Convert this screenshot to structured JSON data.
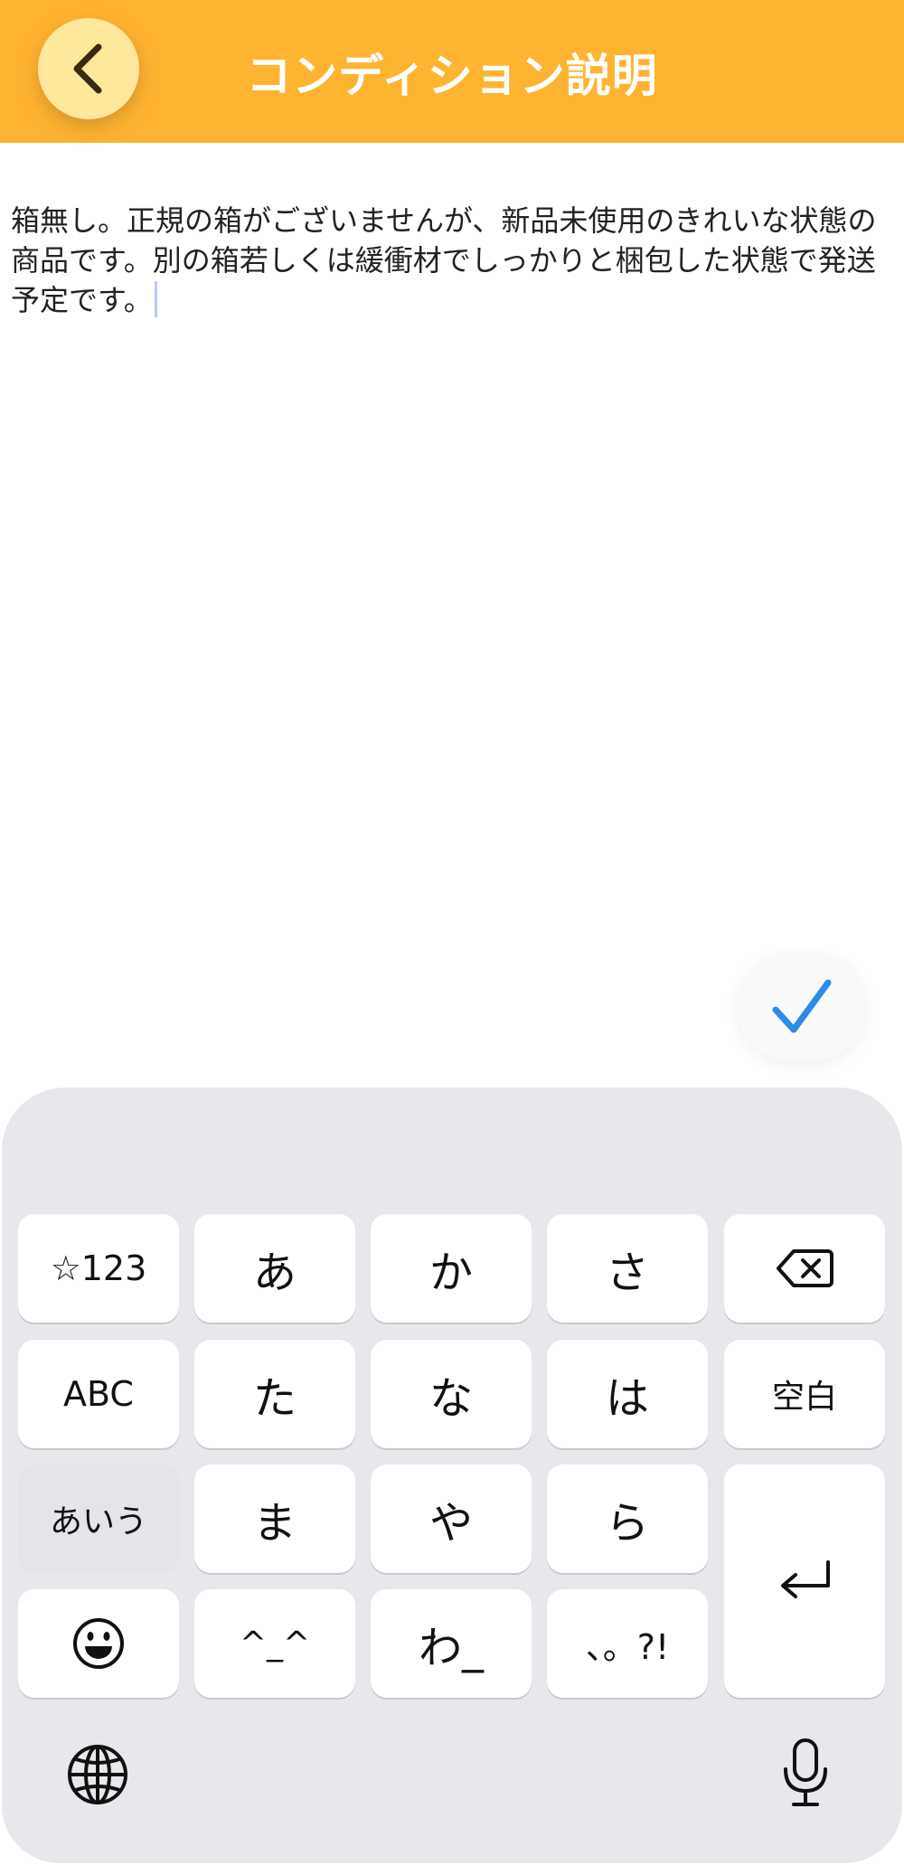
{
  "header": {
    "title": "コンディション説明",
    "back_icon": "chevron-left-icon",
    "color": "#ffb431"
  },
  "editor": {
    "text": "箱無し。正規の箱がございませんが、新品未使用のきれいな状態の商品です。別の箱若しくは緩衝材でしっかりと梱包した状態で発送予定です。"
  },
  "done_icon": "checkmark-icon",
  "keyboard": {
    "row1": [
      "☆123",
      "あ",
      "か",
      "さ"
    ],
    "delete_icon": "backspace-icon",
    "row2": [
      "ABC",
      "た",
      "な",
      "は",
      "空白"
    ],
    "row3": [
      "あいう",
      "ま",
      "や",
      "ら"
    ],
    "return_icon": "return-icon",
    "emoji_icon": "emoji-icon",
    "row4": [
      "^_^",
      "わ_",
      "、。?!"
    ],
    "globe_icon": "globe-icon",
    "mic_icon": "microphone-icon"
  }
}
